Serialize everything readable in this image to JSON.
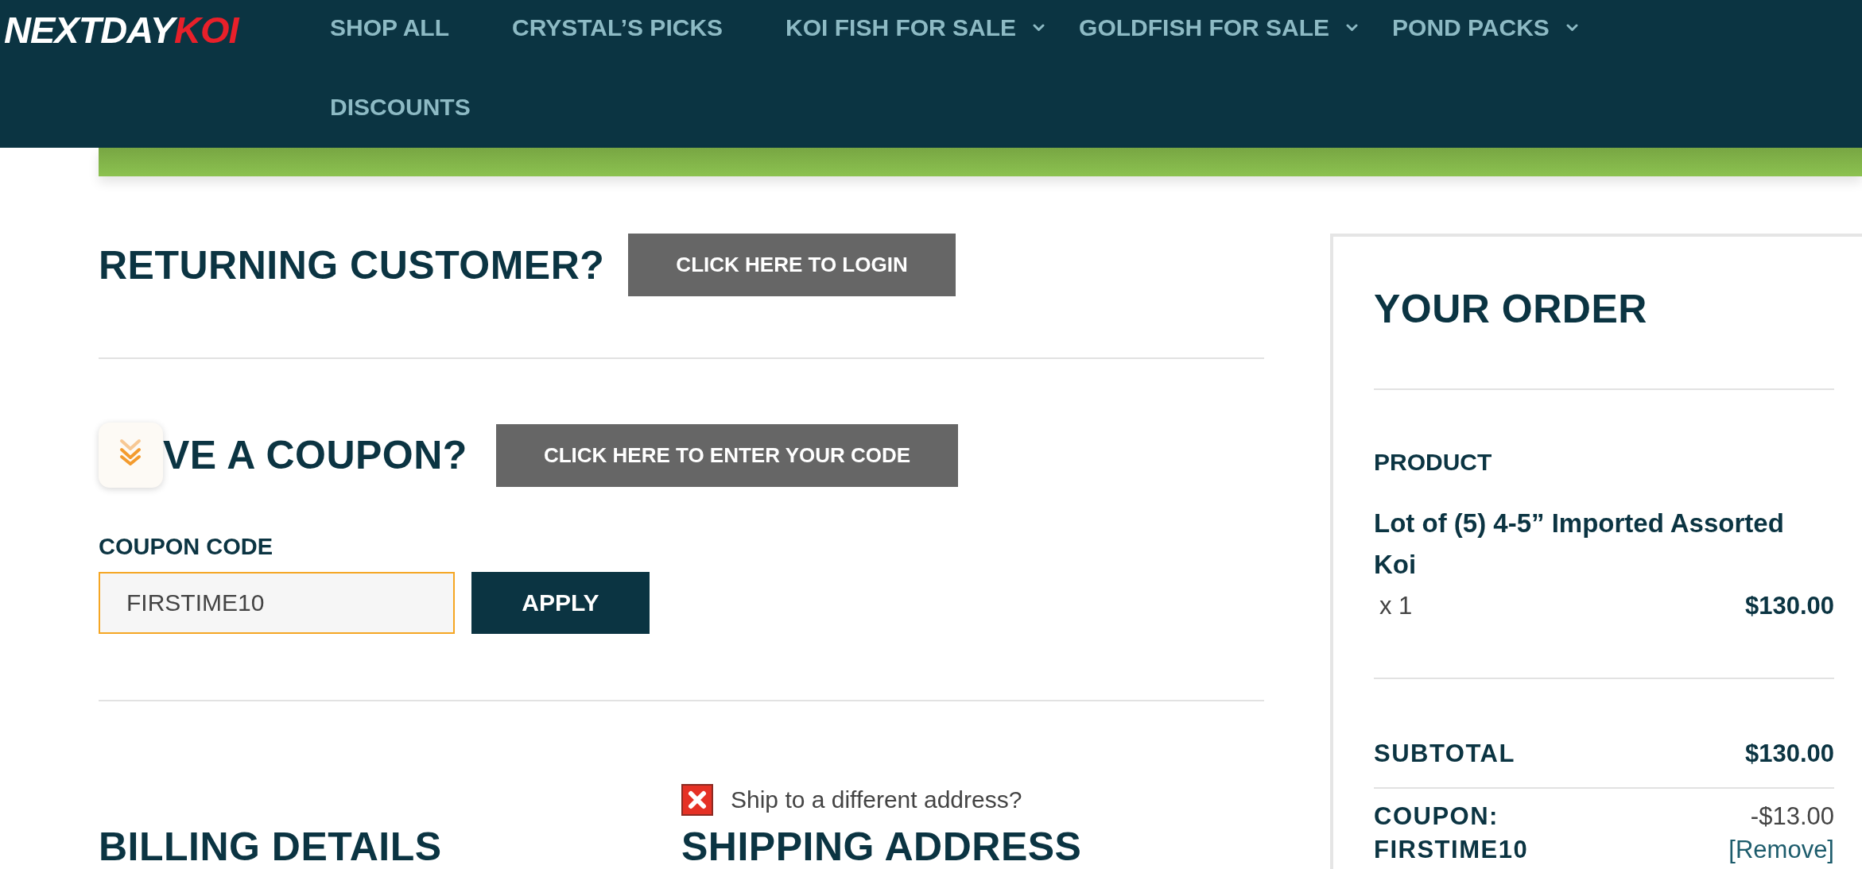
{
  "header": {
    "logo": {
      "primary": "NEXTDAY",
      "accent": "KOI"
    },
    "nav": [
      {
        "label": "SHOP ALL",
        "has_submenu": false
      },
      {
        "label": "CRYSTAL’S PICKS",
        "has_submenu": false
      },
      {
        "label": "KOI FISH FOR SALE",
        "has_submenu": true
      },
      {
        "label": "GOLDFISH FOR SALE",
        "has_submenu": true
      },
      {
        "label": "POND PACKS",
        "has_submenu": true
      },
      {
        "label": "DISCOUNTS",
        "has_submenu": false
      }
    ]
  },
  "returning_customer": {
    "heading": "RETURNING CUSTOMER?",
    "button": "CLICK HERE TO LOGIN"
  },
  "coupon": {
    "heading": "VE A COUPON?",
    "button": "CLICK HERE TO ENTER YOUR CODE",
    "field_label": "COUPON CODE",
    "field_value": "FIRSTIME10",
    "focused": true,
    "apply_button": "APPLY"
  },
  "billing": {
    "heading": "BILLING DETAILS"
  },
  "shipping": {
    "option": {
      "label": "Ship to a different address?",
      "checked": false
    },
    "heading": "SHIPPING ADDRESS"
  },
  "order": {
    "heading": "YOUR ORDER",
    "column": "PRODUCT",
    "items": [
      {
        "name": "Lot of (5) 4-5” Imported Assorted Koi",
        "quantity": "x 1",
        "price": "$130.00"
      }
    ],
    "totals": [
      {
        "kind": "subtotal",
        "label": "SUBTOTAL",
        "value": "$130.00"
      },
      {
        "kind": "coupon",
        "label": "COUPON: FIRSTIME10",
        "value": "-$13.00",
        "action": "[Remove]"
      }
    ]
  }
}
